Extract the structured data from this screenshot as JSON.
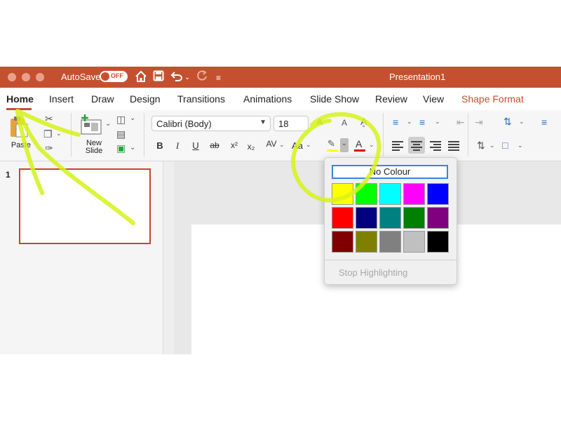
{
  "titlebar": {
    "autosave_label": "AutoSave",
    "autosave_state": "OFF",
    "doc_title": "Presentation1",
    "bg_color": "#c5502f",
    "icons": [
      "home-icon",
      "save-icon",
      "undo-icon",
      "redo-icon",
      "customize-toolbar-icon"
    ]
  },
  "tabs": [
    {
      "label": "Home"
    },
    {
      "label": "Insert"
    },
    {
      "label": "Draw"
    },
    {
      "label": "Design"
    },
    {
      "label": "Transitions"
    },
    {
      "label": "Animations"
    },
    {
      "label": "Slide Show"
    },
    {
      "label": "Review"
    },
    {
      "label": "View"
    },
    {
      "label": "Shape Format"
    }
  ],
  "ribbon": {
    "paste_label": "Paste",
    "new_slide_label_1": "New",
    "new_slide_label_2": "Slide",
    "font_name": "Calibri (Body)",
    "font_size": "18",
    "bold": "B",
    "italic": "I",
    "underline": "U",
    "strikethrough": "ab",
    "superscript": "x²",
    "subscript": "x₂",
    "char_spacing": "AV",
    "change_case": "Aa",
    "font_color_letter": "A",
    "highlight_color": "#ffff00",
    "font_color": "#e00000"
  },
  "slides_pane": {
    "slide_number": "1"
  },
  "highlight_menu": {
    "no_colour_label": "No Colour",
    "stop_highlighting_label": "Stop Highlighting",
    "colors": [
      [
        "#ffff00",
        "#00ff00",
        "#00ffff",
        "#ff00ff",
        "#0000ff"
      ],
      [
        "#ff0000",
        "#000080",
        "#008080",
        "#008000",
        "#800080"
      ],
      [
        "#800000",
        "#808000",
        "#808080",
        "#c0c0c0",
        "#000000"
      ]
    ]
  },
  "annotation_color": "#d7f21a"
}
